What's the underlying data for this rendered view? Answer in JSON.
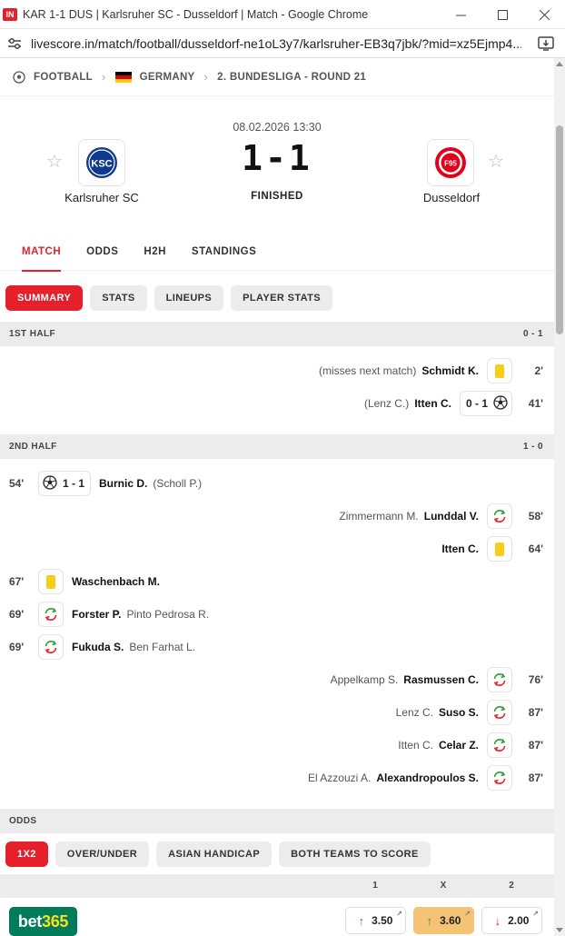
{
  "window": {
    "favicon": "IN",
    "title": "KAR 1-1 DUS | Karlsruher SC - Dusseldorf | Match - Google Chrome",
    "url": "livescore.in/match/football/dusseldorf-ne1oL3y7/karlsruher-EB3q7jbk/?mid=xz5Ejmp4..."
  },
  "breadcrumb": {
    "sport": "FOOTBALL",
    "country": "GERMANY",
    "league": "2. BUNDESLIGA - ROUND 21"
  },
  "match": {
    "datetime": "08.02.2026 13:30",
    "score": "1-1",
    "status": "FINISHED",
    "home": {
      "name": "Karlsruher SC",
      "logo_text": "KSC"
    },
    "away": {
      "name": "Dusseldorf",
      "logo_text": "F95"
    }
  },
  "tabs": [
    "MATCH",
    "ODDS",
    "H2H",
    "STANDINGS"
  ],
  "subtabs": [
    "SUMMARY",
    "STATS",
    "LINEUPS",
    "PLAYER STATS"
  ],
  "first_half": {
    "label": "1ST HALF",
    "score": "0 - 1",
    "events": [
      {
        "side": "away",
        "minute": "2'",
        "type": "yellow-card",
        "player": "Schmidt K.",
        "secondary": "(misses next match)"
      },
      {
        "side": "away",
        "minute": "41'",
        "type": "goal",
        "player": "Itten C.",
        "secondary": "(Lenz C.)",
        "score": "0 - 1"
      }
    ]
  },
  "second_half": {
    "label": "2ND HALF",
    "score": "1 - 0",
    "events": [
      {
        "side": "home",
        "minute": "54'",
        "type": "goal",
        "player": "Burnic D.",
        "secondary": "(Scholl P.)",
        "score": "1 - 1"
      },
      {
        "side": "away",
        "minute": "58'",
        "type": "substitution",
        "player": "Lunddal V.",
        "secondary": "Zimmermann M."
      },
      {
        "side": "away",
        "minute": "64'",
        "type": "yellow-card",
        "player": "Itten C.",
        "secondary": ""
      },
      {
        "side": "home",
        "minute": "67'",
        "type": "yellow-card",
        "player": "Waschenbach M.",
        "secondary": ""
      },
      {
        "side": "home",
        "minute": "69'",
        "type": "substitution",
        "player": "Forster P.",
        "secondary": "Pinto Pedrosa R."
      },
      {
        "side": "home",
        "minute": "69'",
        "type": "substitution",
        "player": "Fukuda S.",
        "secondary": "Ben Farhat L."
      },
      {
        "side": "away",
        "minute": "76'",
        "type": "substitution",
        "player": "Rasmussen C.",
        "secondary": "Appelkamp S."
      },
      {
        "side": "away",
        "minute": "87'",
        "type": "substitution",
        "player": "Suso S.",
        "secondary": "Lenz C."
      },
      {
        "side": "away",
        "minute": "87'",
        "type": "substitution",
        "player": "Celar Z.",
        "secondary": "Itten C."
      },
      {
        "side": "away",
        "minute": "87'",
        "type": "substitution",
        "player": "Alexandropoulos S.",
        "secondary": "El Azzouzi A."
      }
    ]
  },
  "odds": {
    "label": "ODDS",
    "chips": [
      "1X2",
      "OVER/UNDER",
      "ASIAN HANDICAP",
      "BOTH TEAMS TO SCORE"
    ],
    "columns": [
      "1",
      "X",
      "2"
    ],
    "bookmaker": {
      "name_main": "bet",
      "name_accent": "365"
    },
    "values": [
      {
        "value": "3.50",
        "trend": "up",
        "highlight": false
      },
      {
        "value": "3.60",
        "trend": "up",
        "highlight": true
      },
      {
        "value": "2.00",
        "trend": "down",
        "highlight": false
      }
    ]
  },
  "colors": {
    "accent": "#e5202b",
    "yellow_card": "#f7cd17",
    "trend_up": "#2e9d3a",
    "trend_down": "#e5202b",
    "bet365_green": "#027b5b",
    "bet365_yellow": "#ffdf1b"
  }
}
